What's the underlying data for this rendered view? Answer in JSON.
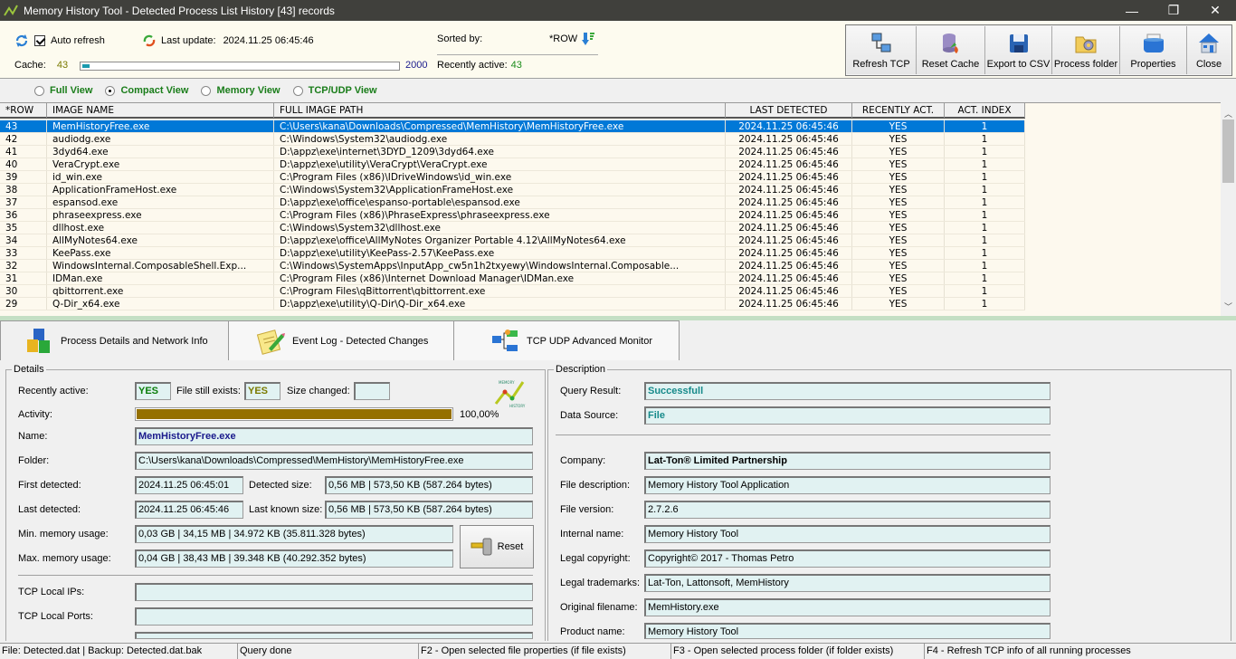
{
  "window": {
    "title": "Memory History Tool - Detected Process List History [43] records",
    "minimize": "—",
    "maximize": "❐",
    "close": "✕"
  },
  "topbar": {
    "auto_refresh_label": "Auto refresh",
    "auto_refresh_checked": true,
    "last_update_label": "Last update:",
    "last_update_value": "2024.11.25 06:45:46",
    "sorted_by_label": "Sorted by:",
    "sorted_by_value": "*ROW",
    "cache_label": "Cache:",
    "cache_value": "43",
    "cache_max": "2000",
    "cache_fraction": 0.0215,
    "recently_active_label": "Recently active:",
    "recently_active_value": "43"
  },
  "toolbar": {
    "buttons": [
      {
        "label": "Refresh TCP",
        "icon": "network-computers-icon"
      },
      {
        "label": "Reset Cache",
        "icon": "database-reset-icon"
      },
      {
        "label": "Export to CSV",
        "icon": "floppy-disk-icon"
      },
      {
        "label": "Process folder",
        "icon": "folder-gear-icon"
      },
      {
        "label": "Properties",
        "icon": "blue-box-icon"
      },
      {
        "label": "Close",
        "icon": "home-icon"
      }
    ]
  },
  "views": [
    {
      "label": "Full View",
      "selected": false
    },
    {
      "label": "Compact View",
      "selected": true
    },
    {
      "label": "Memory View",
      "selected": false
    },
    {
      "label": "TCP/UDP View",
      "selected": false
    }
  ],
  "grid": {
    "columns": [
      "*ROW",
      "IMAGE NAME",
      "FULL IMAGE PATH",
      "LAST DETECTED",
      "RECENTLY ACT.",
      "ACT. INDEX"
    ],
    "rows": [
      [
        "43",
        "MemHistoryFree.exe",
        "C:\\Users\\kana\\Downloads\\Compressed\\MemHistory\\MemHistoryFree.exe",
        "2024.11.25 06:45:46",
        "YES",
        "1"
      ],
      [
        "42",
        "audiodg.exe",
        "C:\\Windows\\System32\\audiodg.exe",
        "2024.11.25 06:45:46",
        "YES",
        "1"
      ],
      [
        "41",
        "3dyd64.exe",
        "D:\\appz\\exe\\internet\\3DYD_1209\\3dyd64.exe",
        "2024.11.25 06:45:46",
        "YES",
        "1"
      ],
      [
        "40",
        "VeraCrypt.exe",
        "D:\\appz\\exe\\utility\\VeraCrypt\\VeraCrypt.exe",
        "2024.11.25 06:45:46",
        "YES",
        "1"
      ],
      [
        "39",
        "id_win.exe",
        "C:\\Program Files (x86)\\IDriveWindows\\id_win.exe",
        "2024.11.25 06:45:46",
        "YES",
        "1"
      ],
      [
        "38",
        "ApplicationFrameHost.exe",
        "C:\\Windows\\System32\\ApplicationFrameHost.exe",
        "2024.11.25 06:45:46",
        "YES",
        "1"
      ],
      [
        "37",
        "espansod.exe",
        "D:\\appz\\exe\\office\\espanso-portable\\espansod.exe",
        "2024.11.25 06:45:46",
        "YES",
        "1"
      ],
      [
        "36",
        "phraseexpress.exe",
        "C:\\Program Files (x86)\\PhraseExpress\\phraseexpress.exe",
        "2024.11.25 06:45:46",
        "YES",
        "1"
      ],
      [
        "35",
        "dllhost.exe",
        "C:\\Windows\\System32\\dllhost.exe",
        "2024.11.25 06:45:46",
        "YES",
        "1"
      ],
      [
        "34",
        "AllMyNotes64.exe",
        "D:\\appz\\exe\\office\\AllMyNotes Organizer Portable 4.12\\AllMyNotes64.exe",
        "2024.11.25 06:45:46",
        "YES",
        "1"
      ],
      [
        "33",
        "KeePass.exe",
        "D:\\appz\\exe\\utility\\KeePass-2.57\\KeePass.exe",
        "2024.11.25 06:45:46",
        "YES",
        "1"
      ],
      [
        "32",
        "WindowsInternal.ComposableShell.Exp...",
        "C:\\Windows\\SystemApps\\InputApp_cw5n1h2txyewy\\WindowsInternal.Composable...",
        "2024.11.25 06:45:46",
        "YES",
        "1"
      ],
      [
        "31",
        "IDMan.exe",
        "C:\\Program Files (x86)\\Internet Download Manager\\IDMan.exe",
        "2024.11.25 06:45:46",
        "YES",
        "1"
      ],
      [
        "30",
        "qbittorrent.exe",
        "C:\\Program Files\\qBittorrent\\qbittorrent.exe",
        "2024.11.25 06:45:46",
        "YES",
        "1"
      ],
      [
        "29",
        "Q-Dir_x64.exe",
        "D:\\appz\\exe\\utility\\Q-Dir\\Q-Dir_x64.exe",
        "2024.11.25 06:45:46",
        "YES",
        "1"
      ]
    ],
    "selected_row": 0
  },
  "tabs": [
    {
      "label": "Process Details and Network Info",
      "icon": "cubes-icon"
    },
    {
      "label": "Event Log - Detected Changes",
      "icon": "notepad-pencil-icon"
    },
    {
      "label": "TCP UDP Advanced Monitor",
      "icon": "network-diagram-icon"
    }
  ],
  "details": {
    "legend": "Details",
    "recently_active_label": "Recently active:",
    "recently_active_value": "YES",
    "file_exists_label": "File still exists:",
    "file_exists_value": "YES",
    "size_changed_label": "Size changed:",
    "size_changed_value": "",
    "activity_label": "Activity:",
    "activity_percent": 100,
    "activity_text": "100,00%",
    "name_label": "Name:",
    "name_value": "MemHistoryFree.exe",
    "folder_label": "Folder:",
    "folder_value": "C:\\Users\\kana\\Downloads\\Compressed\\MemHistory\\MemHistoryFree.exe",
    "first_detected_label": "First detected:",
    "first_detected_value": "2024.11.25 06:45:01",
    "detected_size_label": "Detected size:",
    "detected_size_value": "0,56 MB | 573,50 KB (587.264 bytes)",
    "last_detected_label": "Last detected:",
    "last_detected_value": "2024.11.25 06:45:46",
    "last_known_size_label": "Last known size:",
    "last_known_size_value": "0,56 MB | 573,50 KB (587.264 bytes)",
    "min_mem_label": "Min. memory usage:",
    "min_mem_value": "0,03 GB | 34,15 MB | 34.972 KB (35.811.328 bytes)",
    "max_mem_label": "Max. memory usage:",
    "max_mem_value": "0,04 GB | 38,43 MB | 39.348 KB (40.292.352 bytes)",
    "reset_label": "Reset",
    "tcp_ips_label": "TCP Local IPs:",
    "tcp_ips_value": "",
    "tcp_ports_label": "TCP Local Ports:",
    "tcp_ports_value": ""
  },
  "description": {
    "legend": "Description",
    "query_result_label": "Query Result:",
    "query_result_value": "Successfull",
    "data_source_label": "Data Source:",
    "data_source_value": "File",
    "company_label": "Company:",
    "company_value": "Lat-Ton® Limited Partnership",
    "file_desc_label": "File description:",
    "file_desc_value": "Memory History Tool Application",
    "file_version_label": "File version:",
    "file_version_value": "2.7.2.6",
    "internal_name_label": "Internal name:",
    "internal_name_value": "Memory History Tool",
    "copyright_label": "Legal copyright:",
    "copyright_value": "Copyright© 2017 - Thomas Petro",
    "trademarks_label": "Legal trademarks:",
    "trademarks_value": "Lat-Ton, Lattonsoft, MemHistory",
    "orig_filename_label": "Original filename:",
    "orig_filename_value": "MemHistory.exe",
    "product_name_label": "Product name:",
    "product_name_value": "Memory History Tool"
  },
  "statusbar": [
    "File: Detected.dat | Backup: Detected.dat.bak",
    "Query done",
    "F2 - Open selected file properties (if file exists)",
    "F3 - Open selected process folder (if folder exists)",
    "F4 - Refresh TCP info of all running processes"
  ],
  "colors": {
    "selection": "#0078d7",
    "activity_bar": "#957000",
    "cache_bar": "#1a9aae",
    "field_bg": "#e1f2f2",
    "view_label": "#1a7d1a",
    "titlebar": "#40403c"
  }
}
